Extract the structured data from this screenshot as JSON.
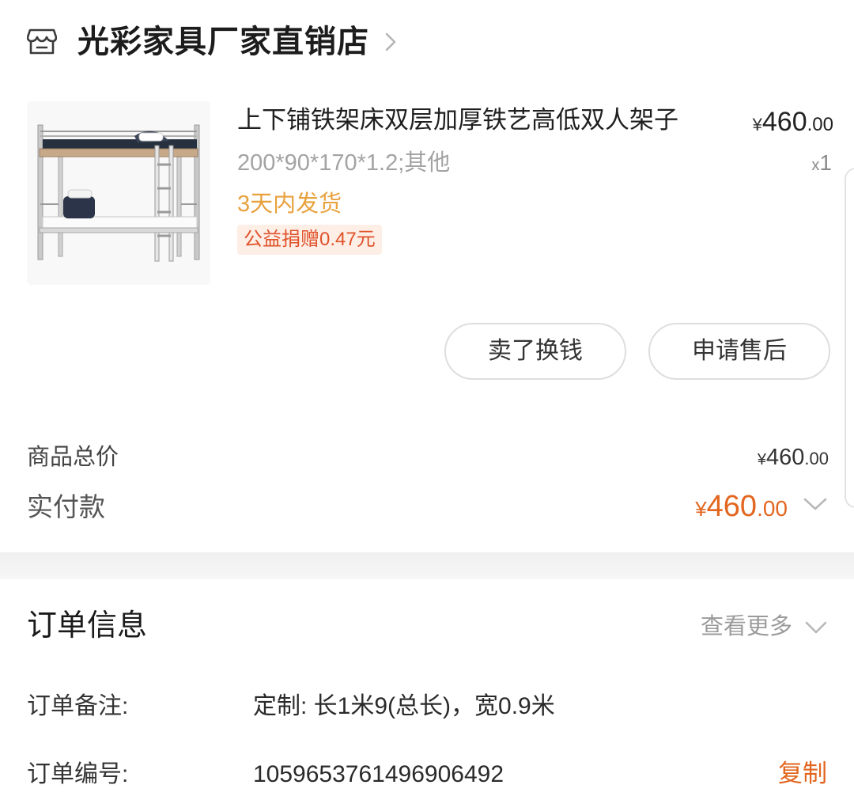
{
  "shop": {
    "icon": "store-icon",
    "name": "光彩家具厂家直销店",
    "chevron": "chevron-right-icon"
  },
  "product": {
    "image_icon": "bunk-bed-image",
    "title": "上下铺铁架床双层加厚铁艺高低双人架子",
    "spec": "200*90*170*1.2;其他",
    "shipping": "3天内发货",
    "charity": "公益捐赠0.47元",
    "price": {
      "currency": "¥",
      "integer": "460",
      "decimal": ".00"
    },
    "qty_prefix": "x",
    "qty": "1"
  },
  "actions": {
    "sell_label": "卖了换钱",
    "after_sale_label": "申请售后"
  },
  "summary": {
    "total_label": "商品总价",
    "total": {
      "currency": "¥",
      "integer": "460",
      "decimal": ".00"
    },
    "paid_label": "实付款",
    "paid": {
      "currency": "¥",
      "integer": "460",
      "decimal": ".00"
    },
    "paid_color": "#e2661f"
  },
  "order_info": {
    "title": "订单信息",
    "view_more": "查看更多",
    "note_label": "订单备注:",
    "note_value": "定制: 长1米9(总长)，宽0.9米",
    "number_label": "订单编号:",
    "number_value": "1059653761496906492",
    "copy_label": "复制"
  },
  "colors": {
    "accent": "#e2661f",
    "shipping": "#e8a13c",
    "charity_bg": "#fdeee6"
  }
}
